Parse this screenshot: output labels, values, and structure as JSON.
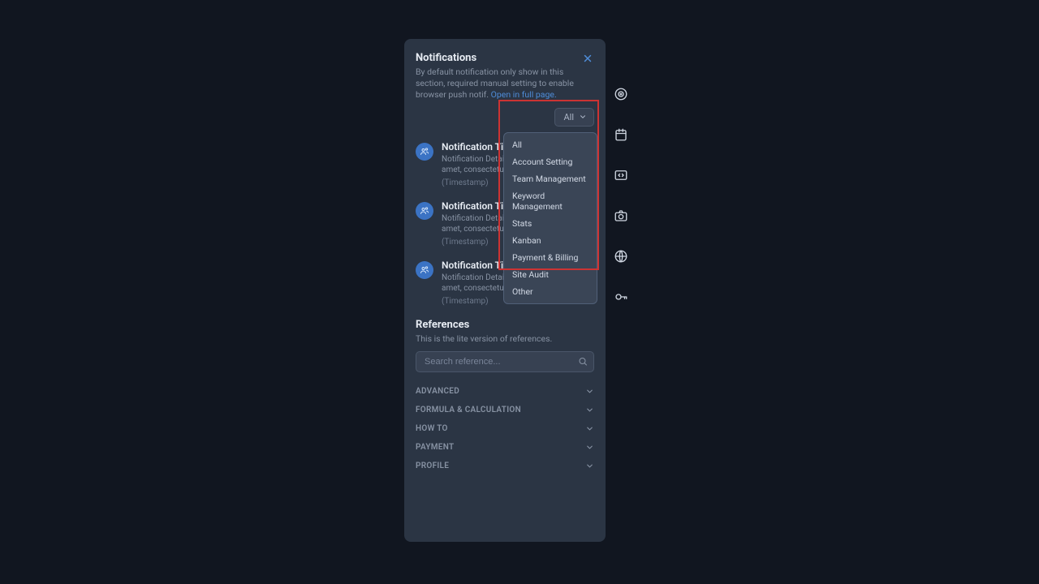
{
  "notifications": {
    "heading": "Notifications",
    "description": "By default notification only show in this section, required manual setting to enable browser push notif. ",
    "open_link": "Open in full page.",
    "filter_label": "All",
    "filter_options": [
      "All",
      "Account Setting",
      "Team Management",
      "Keyword Management",
      "Stats",
      "Kanban",
      "Payment & Billing",
      "Site Audit",
      "Other"
    ],
    "items": [
      {
        "title": "Notification Title",
        "detail": "Notification Detail: Lorem ipsum dolor sit amet, consectetur adipiscing elit.",
        "timestamp": "(Timestamp)"
      },
      {
        "title": "Notification Title",
        "detail": "Notification Detail: Lorem ipsum dolor sit amet, consectetur adipiscing elit.",
        "timestamp": "(Timestamp)"
      },
      {
        "title": "Notification Title",
        "detail": "Notification Detail: Lorem ipsum dolor sit amet, consectetur adipiscing elit.",
        "timestamp": "(Timestamp)"
      }
    ]
  },
  "references": {
    "heading": "References",
    "description": "This is the lite version of references.",
    "search_placeholder": "Search reference...",
    "categories": [
      "ADVANCED",
      "FORMULA & CALCULATION",
      "HOW TO",
      "PAYMENT",
      "PROFILE"
    ]
  },
  "rail_icons": [
    "target-icon",
    "calendar-icon",
    "code-icon",
    "camera-icon",
    "globe-icon",
    "key-icon"
  ]
}
